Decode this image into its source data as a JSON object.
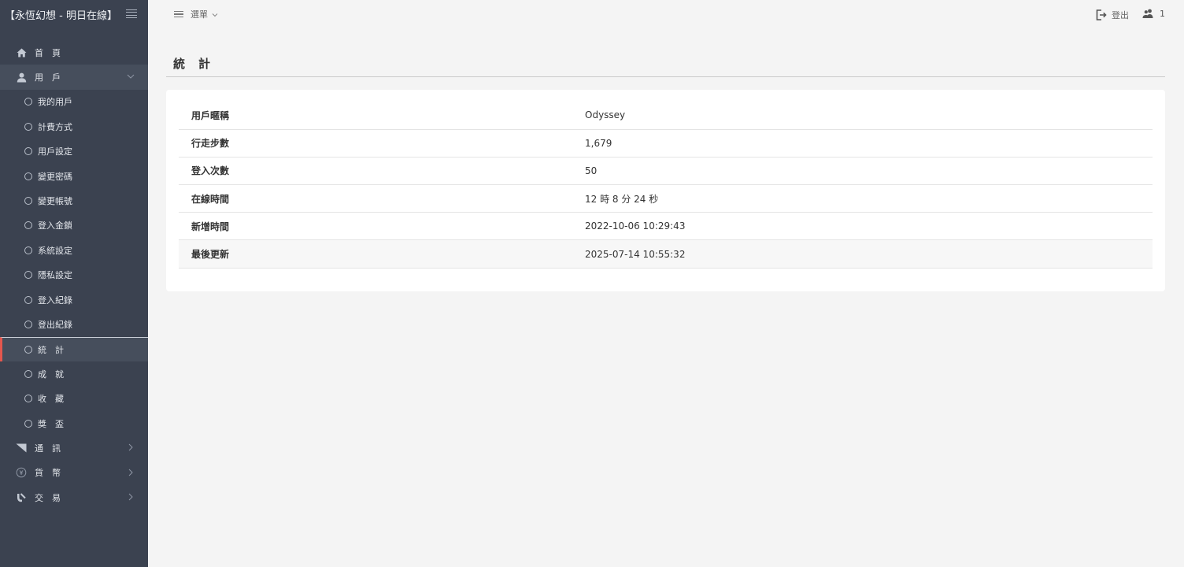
{
  "app": {
    "title": "【永恆幻想 - 明日在線】"
  },
  "topbar": {
    "menu_label": "選單",
    "logout_label": "登出",
    "user_count": "1"
  },
  "sidebar": {
    "home": "首　頁",
    "users": "用　戶",
    "user_sub": [
      "我的用戶",
      "計費方式",
      "用戶設定",
      "變更密碼",
      "變更帳號",
      "登入金鎖",
      "系統設定",
      "隱私設定",
      "登入紀錄",
      "登出紀錄",
      "統　計",
      "成　就",
      "收　藏",
      "獎　盃"
    ],
    "active_index": 10,
    "notify": "通　訊",
    "currency": "貨　幣",
    "trade": "交　易"
  },
  "page": {
    "title": "統　計"
  },
  "stats": [
    {
      "label": "用戶暱稱",
      "value": "Odyssey"
    },
    {
      "label": "行走步數",
      "value": "1,679"
    },
    {
      "label": "登入次數",
      "value": "50"
    },
    {
      "label": "在線時間",
      "value": "12 時 8 分 24 秒"
    },
    {
      "label": "新增時間",
      "value": "2022-10-06 10:29:43"
    },
    {
      "label": "最後更新",
      "value": "2025-07-14 10:55:32"
    }
  ],
  "colors": {
    "sidebar_bg": "#3b4250",
    "active_marker": "#e4574e",
    "content_bg": "#f4f4f4"
  }
}
